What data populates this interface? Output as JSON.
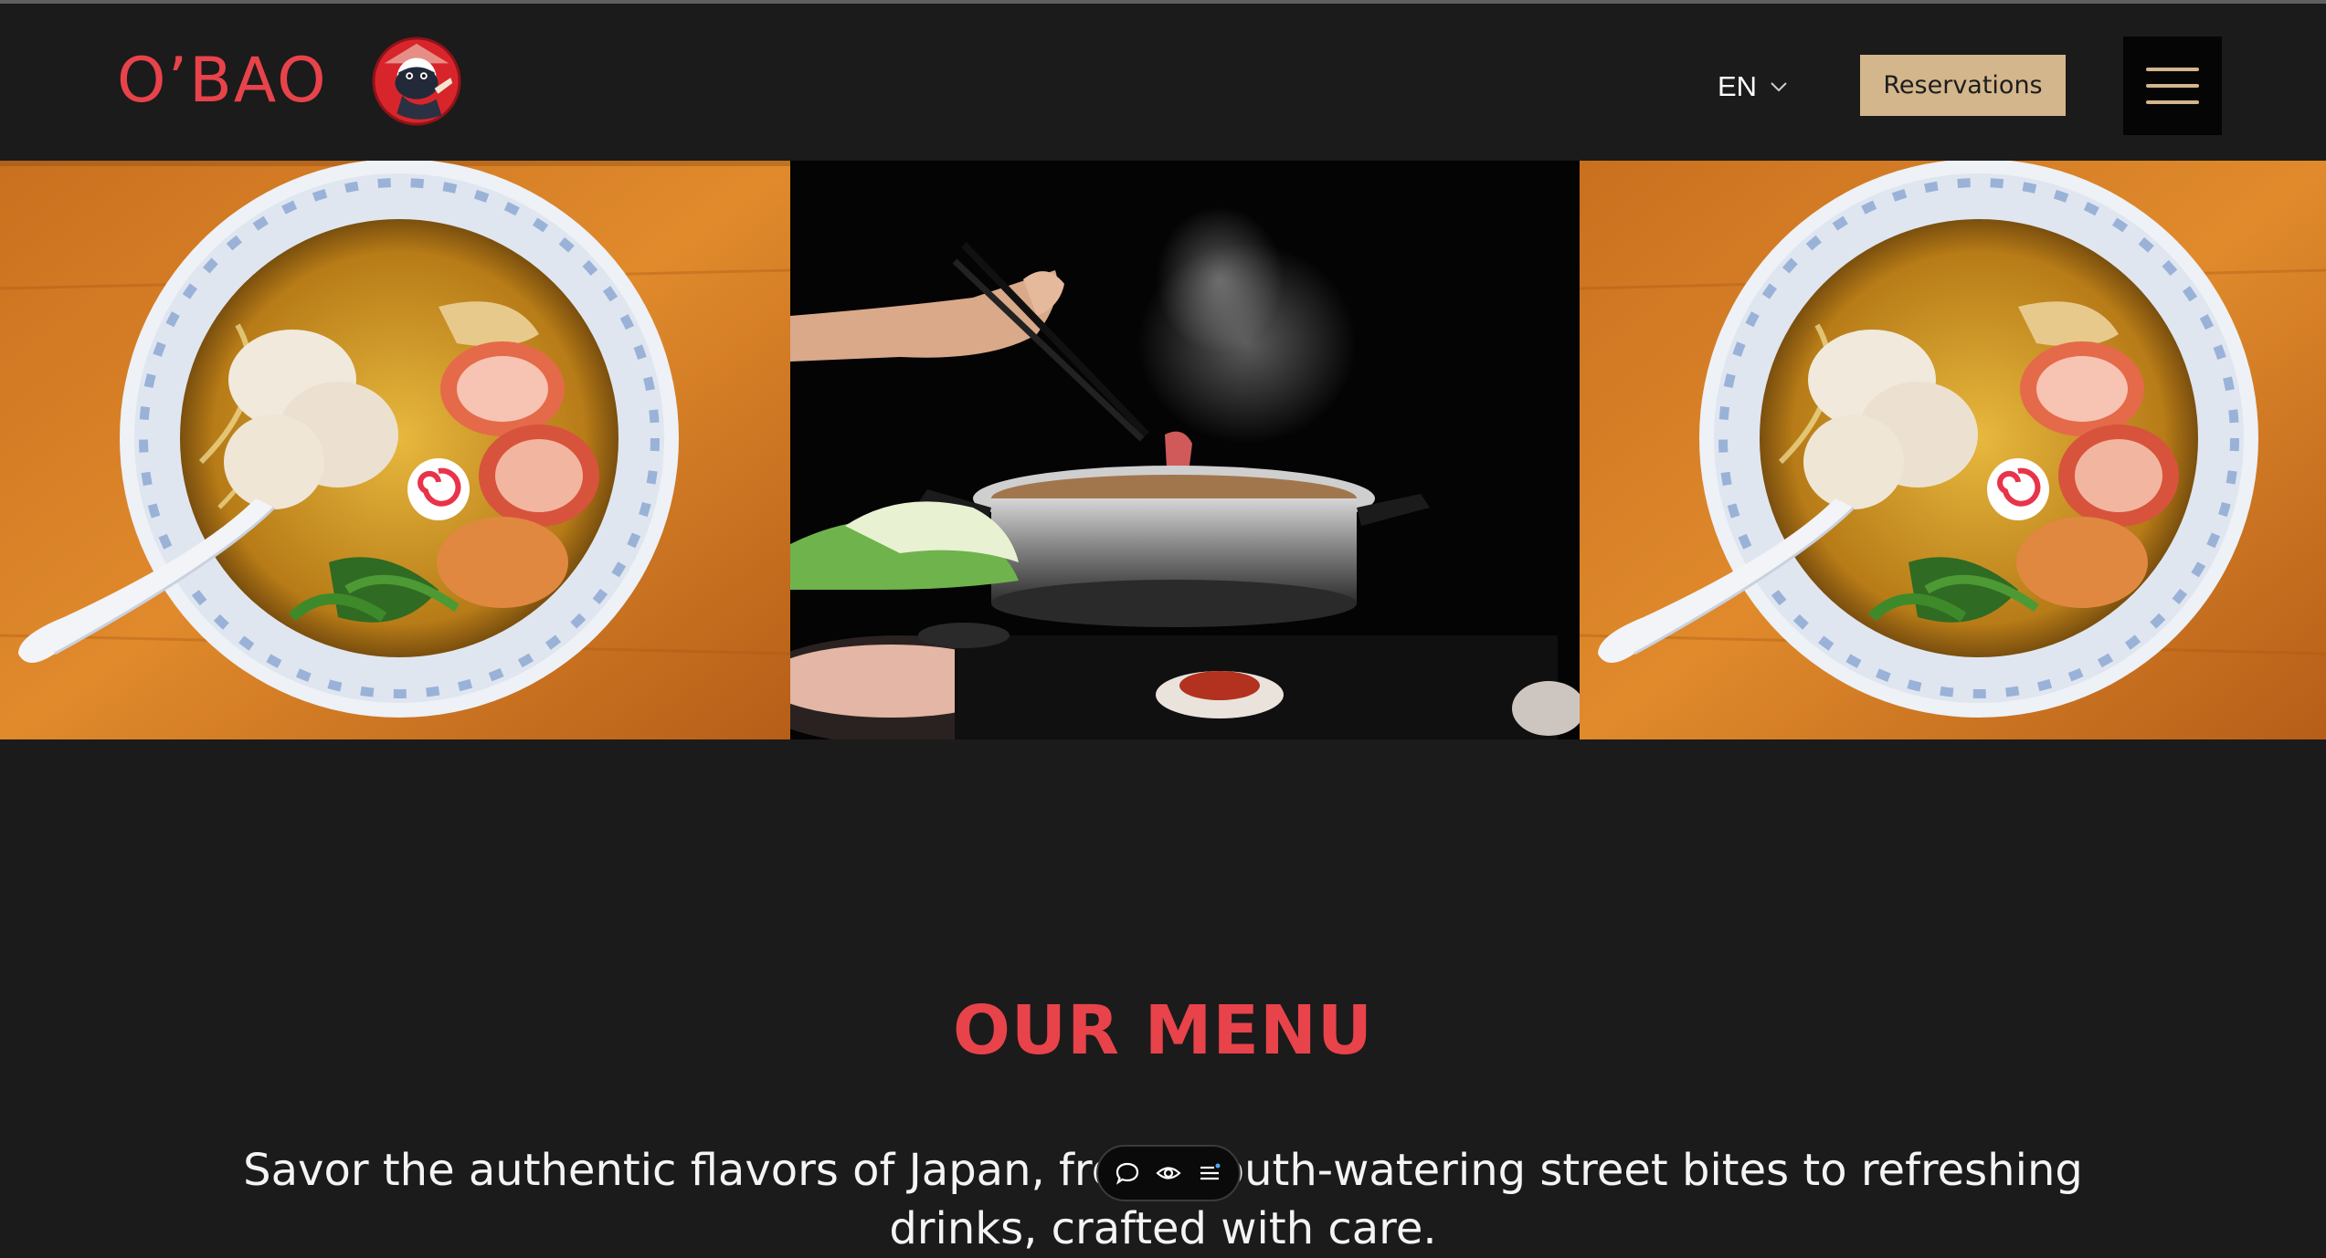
{
  "brand": {
    "name": "O’BAO",
    "accent_color": "#e8434a"
  },
  "header": {
    "language": "EN",
    "reservations_label": "Reservations",
    "button_color": "#d3b68c",
    "menu_icon": "hamburger-menu-icon"
  },
  "gallery": [
    {
      "subject": "ramen-bowl-photo"
    },
    {
      "subject": "hot-pot-photo"
    },
    {
      "subject": "ramen-bowl-photo"
    }
  ],
  "menu_section": {
    "title": "OUR MENU",
    "intro": "Savor the authentic flavors of Japan, from mouth-watering street bites to refreshing drinks, crafted with care."
  },
  "toolbar": {
    "icons": [
      "comment-icon",
      "eye-icon",
      "list-icon"
    ]
  }
}
